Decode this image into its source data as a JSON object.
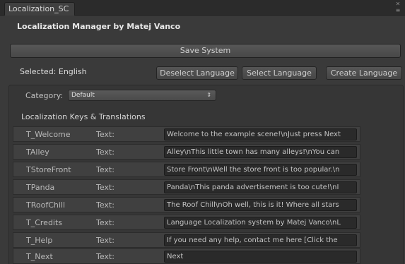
{
  "window": {
    "tab_title": "Localization_SC"
  },
  "header": {
    "title": "Localization Manager by Matej Vanco"
  },
  "toolbar": {
    "save_label": "Save System",
    "selected_label": "Selected: English",
    "deselect_label": "Deselect Language",
    "select_label": "Select Language",
    "create_label": "Create Language"
  },
  "category": {
    "label": "Category:",
    "selected": "Default"
  },
  "keys_section": {
    "title": "Localization Keys & Translations"
  },
  "keys": [
    {
      "key": "T_Welcome",
      "type": "Text:",
      "value": "Welcome to the example scene!\\nJust press Next"
    },
    {
      "key": "TAlley",
      "type": "Text:",
      "value": "Alley\\nThis little town has many alleys!\\nYou can"
    },
    {
      "key": "TStoreFront",
      "type": "Text:",
      "value": "Store Front\\nWell the store front is too popular.\\n"
    },
    {
      "key": "TPanda",
      "type": "Text:",
      "value": "Panda\\nThis panda advertisement is too cute!\\nI"
    },
    {
      "key": "TRoofChill",
      "type": "Text:",
      "value": "The Roof Chill\\nOh well, this is it! Where all stars"
    },
    {
      "key": "T_Credits",
      "type": "Text:",
      "value": "Language Localization system by Matej Vanco\\nL"
    },
    {
      "key": "T_Help",
      "type": "Text:",
      "value": "If you need any help, contact me here [Click the"
    },
    {
      "key": "T_Next",
      "type": "Text:",
      "value": "Next"
    }
  ],
  "colors": {
    "background": "#3a3a3a",
    "panel": "#363636",
    "row": "#404040",
    "field": "#2a2a2a"
  }
}
